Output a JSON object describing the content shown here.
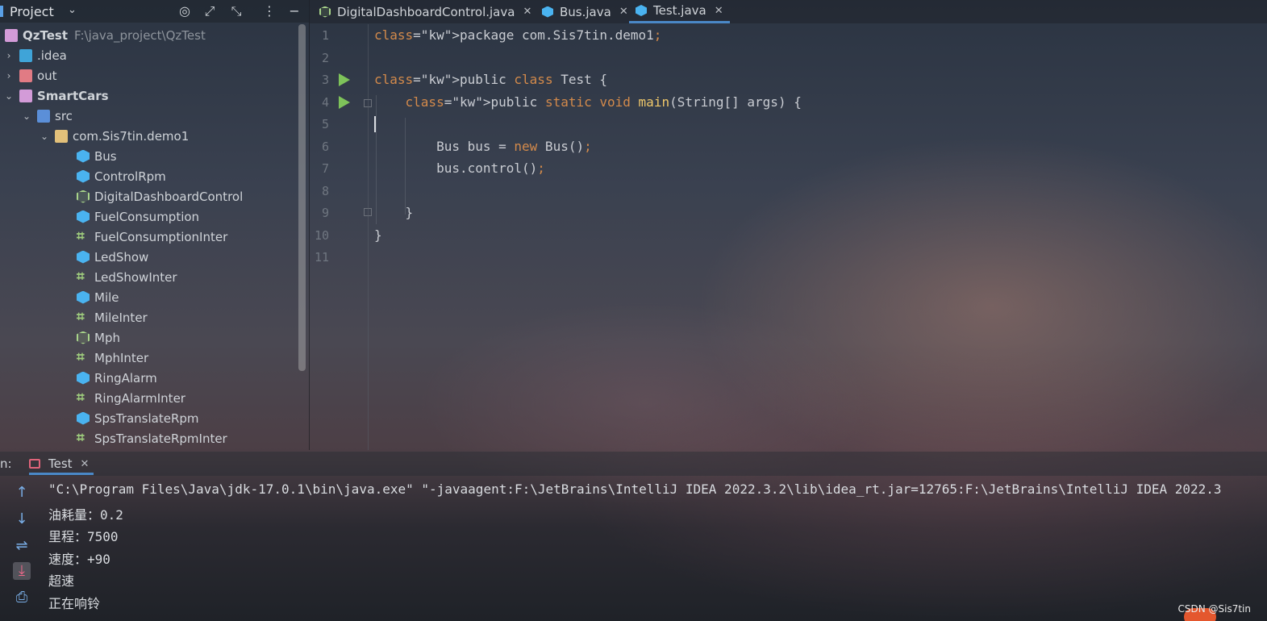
{
  "project_panel": {
    "title": "Project",
    "tools": [
      "target-icon",
      "expand-icon",
      "collapse-icon",
      "more-icon",
      "minimize-icon"
    ],
    "tree": [
      {
        "label": "QzTest",
        "path": "F:\\java_project\\QzTest",
        "kind": "module",
        "bold": true
      },
      {
        "label": ".idea",
        "kind": "folder-idea",
        "expand": "collapsed"
      },
      {
        "label": "out",
        "kind": "folder-out",
        "expand": "collapsed"
      },
      {
        "label": "SmartCars",
        "kind": "module",
        "bold": true,
        "expand": "expanded"
      },
      {
        "label": "src",
        "kind": "folder-src",
        "expand": "expanded"
      },
      {
        "label": "com.Sis7tin.demo1",
        "kind": "package",
        "expand": "expanded"
      },
      {
        "label": "Bus",
        "kind": "class"
      },
      {
        "label": "ControlRpm",
        "kind": "class"
      },
      {
        "label": "DigitalDashboardControl",
        "kind": "class-outline"
      },
      {
        "label": "FuelConsumption",
        "kind": "class"
      },
      {
        "label": "FuelConsumptionInter",
        "kind": "interface"
      },
      {
        "label": "LedShow",
        "kind": "class"
      },
      {
        "label": "LedShowInter",
        "kind": "interface"
      },
      {
        "label": "Mile",
        "kind": "class"
      },
      {
        "label": "MileInter",
        "kind": "interface"
      },
      {
        "label": "Mph",
        "kind": "class-outline"
      },
      {
        "label": "MphInter",
        "kind": "interface"
      },
      {
        "label": "RingAlarm",
        "kind": "class"
      },
      {
        "label": "RingAlarmInter",
        "kind": "interface"
      },
      {
        "label": "SpsTranslateRpm",
        "kind": "class"
      },
      {
        "label": "SpsTranslateRpmInter",
        "kind": "interface"
      }
    ]
  },
  "tabs": [
    {
      "label": "DigitalDashboardControl.java",
      "icon": "class-outline",
      "active": false
    },
    {
      "label": "Bus.java",
      "icon": "class",
      "active": false
    },
    {
      "label": "Test.java",
      "icon": "class",
      "active": true
    }
  ],
  "editor": {
    "line_numbers": [
      "1",
      "2",
      "3",
      "4",
      "5",
      "6",
      "7",
      "8",
      "9",
      "10",
      "11"
    ],
    "lines": [
      "package com.Sis7tin.demo1;",
      "",
      "public class Test {",
      "    public static void main(String[] args) {",
      "",
      "        Bus bus = new Bus();",
      "        bus.control();",
      "",
      "    }",
      "}",
      ""
    ]
  },
  "run_panel": {
    "label": "n:",
    "tab_label": "Test",
    "tools": [
      "arrow-up-icon",
      "arrow-down-icon",
      "soft-wrap-icon",
      "scroll-to-end-icon",
      "print-icon"
    ],
    "output": [
      "\"C:\\Program Files\\Java\\jdk-17.0.1\\bin\\java.exe\" \"-javaagent:F:\\JetBrains\\IntelliJ IDEA 2022.3.2\\lib\\idea_rt.jar=12765:F:\\JetBrains\\IntelliJ IDEA 2022.3",
      "油耗量：0.2",
      "里程：7500",
      "速度：+90",
      "超速",
      "正在响铃"
    ]
  },
  "watermark": "CSDN @Sis7tin"
}
